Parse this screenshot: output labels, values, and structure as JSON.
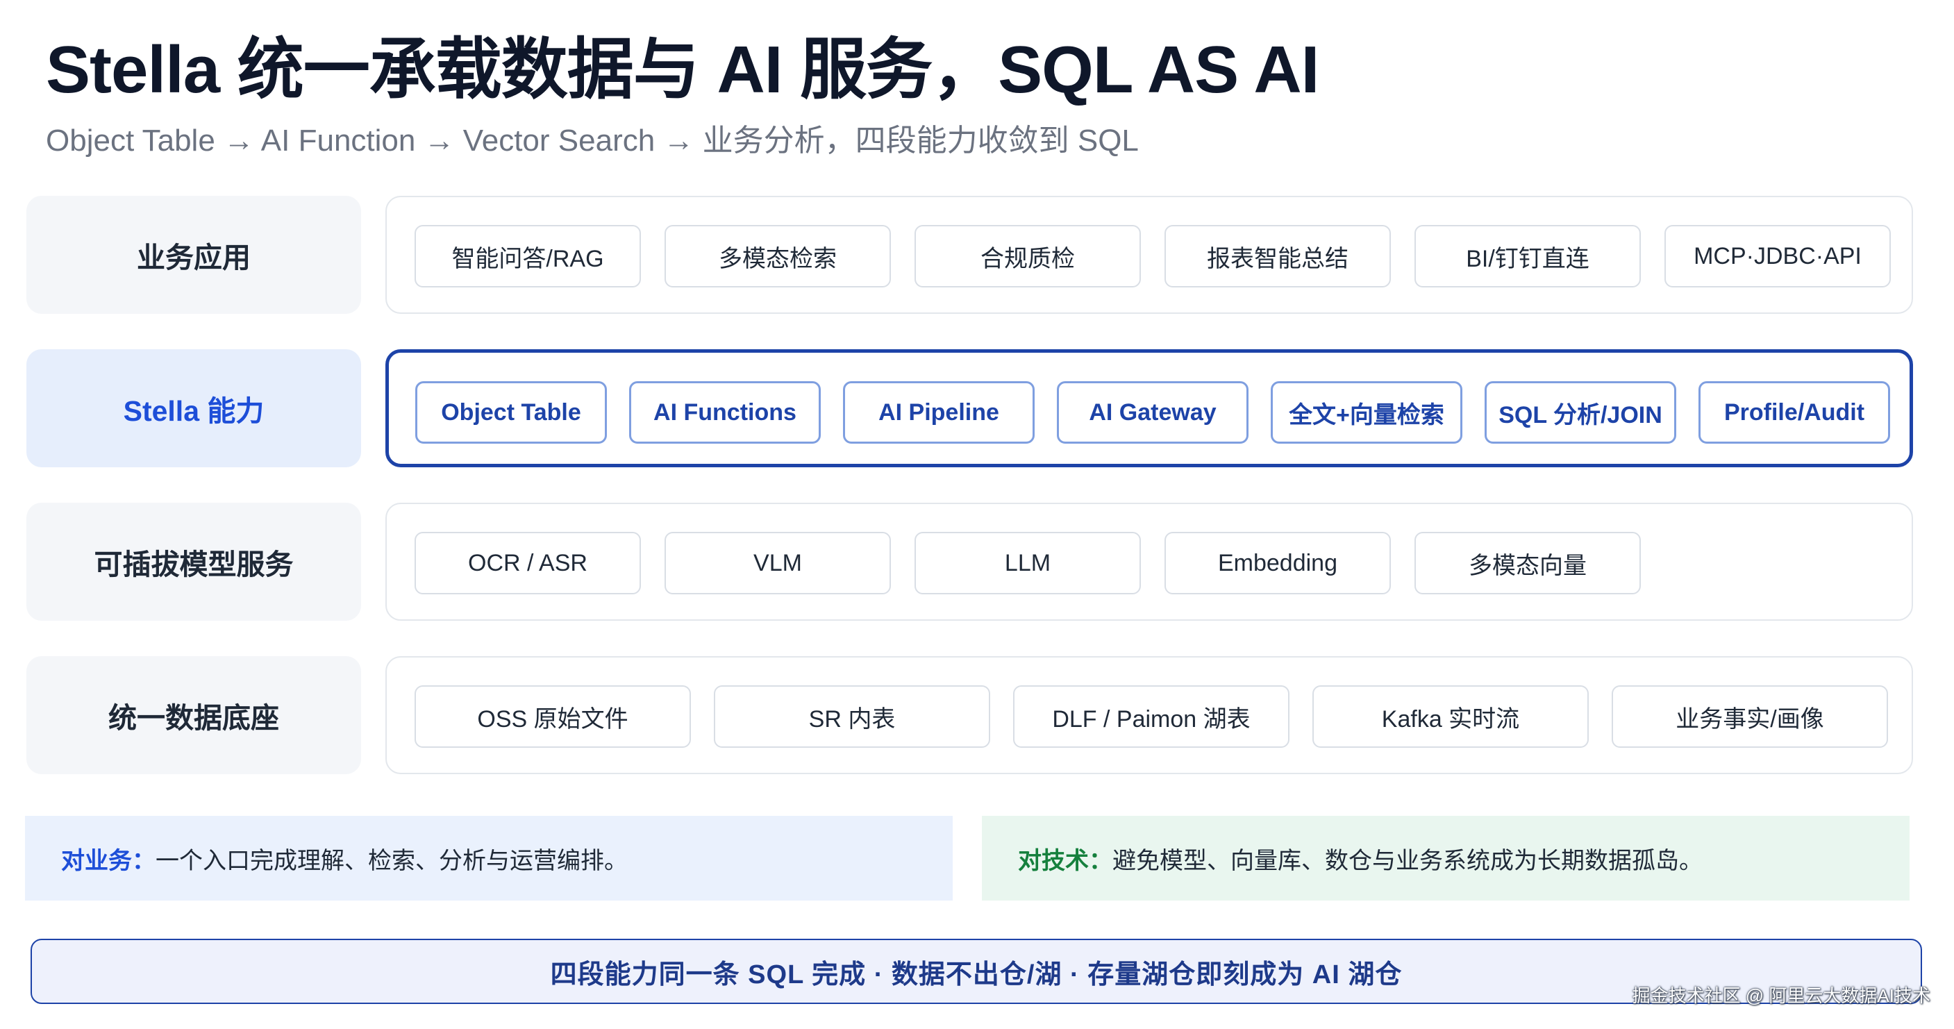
{
  "title": "Stella 统一承载数据与 AI 服务，SQL AS AI",
  "subtitle": "Object Table → AI Function → Vector Search → 业务分析，四段能力收敛到 SQL",
  "rows": [
    {
      "label": "业务应用",
      "items": [
        "智能问答/RAG",
        "多模态检索",
        "合规质检",
        "报表智能总结",
        "BI/钉钉直连",
        "MCP·JDBC·API"
      ]
    },
    {
      "label": "Stella 能力",
      "items": [
        "Object Table",
        "AI Functions",
        "AI Pipeline",
        "AI Gateway",
        "全文+向量检索",
        "SQL 分析/JOIN",
        "Profile/Audit"
      ]
    },
    {
      "label": "可插拔模型服务",
      "items": [
        "OCR / ASR",
        "VLM",
        "LLM",
        "Embedding",
        "多模态向量"
      ]
    },
    {
      "label": "统一数据底座",
      "items": [
        "OSS 原始文件",
        "SR 内表",
        "DLF / Paimon 湖表",
        "Kafka 实时流",
        "业务事实/画像"
      ]
    }
  ],
  "callouts": {
    "business": {
      "lead": "对业务：",
      "text": "一个入口完成理解、检索、分析与运营编排。"
    },
    "tech": {
      "lead": "对技术：",
      "text": "避免模型、向量库、数仓与业务系统成为长期数据孤岛。"
    }
  },
  "banner": "四段能力同一条 SQL 完成 · 数据不出仓/湖 · 存量湖仓即刻成为 AI 湖仓",
  "watermark": "掘金技术社区 @ 阿里云大数据AI技术",
  "colors": {
    "accent": "#1d43a8",
    "accent_text": "#1d4ed8",
    "business_bg": "#eaf1fd",
    "business_lead": "#1d4ed8",
    "tech_bg": "#e9f6ef",
    "tech_lead": "#15803d"
  }
}
